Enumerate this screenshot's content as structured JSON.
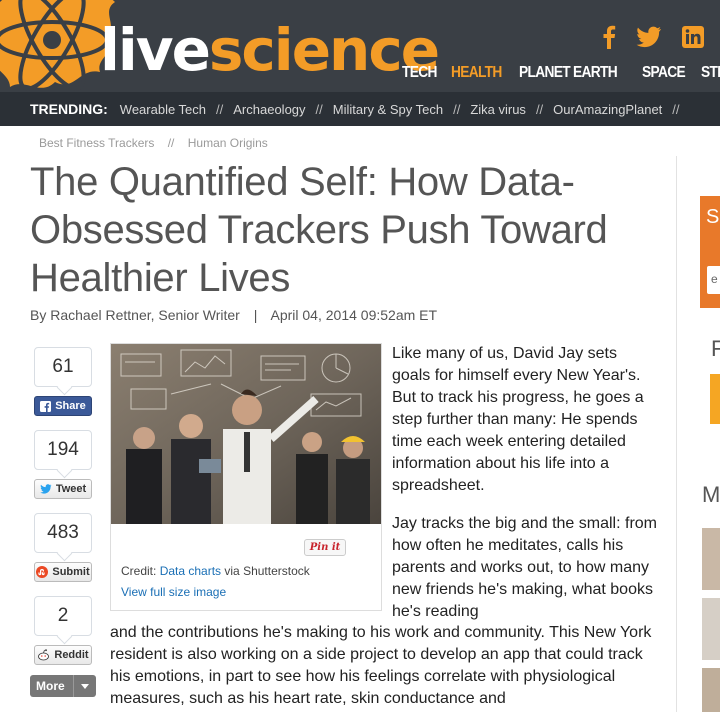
{
  "header": {
    "logo_live": "live",
    "logo_science": "science",
    "brand_colors": {
      "dark": "#3a3f45",
      "orange": "#f39c27"
    },
    "social_icons": [
      "facebook-icon",
      "twitter-icon",
      "linkedin-icon"
    ],
    "nav": [
      {
        "label": "TECH",
        "active": false
      },
      {
        "label": "HEALTH",
        "active": true
      },
      {
        "label": "PLANET EARTH",
        "active": false
      },
      {
        "label": "SPACE",
        "active": false
      },
      {
        "label": "STRANGE NEW",
        "active": false
      }
    ]
  },
  "trending": {
    "label": "TRENDING:",
    "links": [
      "Wearable Tech",
      "Archaeology",
      "Military & Spy Tech",
      "Zika virus",
      "OurAmazingPlanet"
    ],
    "separator": "//"
  },
  "breadcrumb": {
    "items": [
      "Best Fitness Trackers",
      "Human Origins"
    ],
    "separator": "//"
  },
  "article": {
    "title": "The Quantified Self: How Data-Obsessed Trackers Push Toward Healthier Lives",
    "author": "By Rachael Rettner, Senior Writer",
    "date": "April 04, 2014 09:52am ET",
    "byline_separator": "|",
    "p1": "Like many of us, David Jay sets goals for himself every New Year's. But to track his progress, he goes a step further than many: He spends time each week entering detailed information about his life into a spreadsheet.",
    "p2_part1": "Jay tracks the big and the small: from how often he meditates, calls his parents and works out, to how many new friends he's making, what books he's reading",
    "p2_part2": "and the contributions he's making to his work and community. This New York resident is also working on a side project to develop an app that could track his emotions, in part to see how his feelings correlate with physiological measures, such as his heart rate, skin conductance and"
  },
  "figure": {
    "pin_label": "Pin it",
    "credit_prefix": "Credit:",
    "credit_link": "Data charts",
    "credit_suffix": "via Shutterstock",
    "fullsize_link": "View full size image"
  },
  "share": {
    "facebook": {
      "count": "61",
      "label": "Share"
    },
    "twitter": {
      "count": "194",
      "label": "Tweet"
    },
    "stumbleupon": {
      "count": "483",
      "label": "Submit"
    },
    "reddit": {
      "count": "2",
      "label": "Reddit"
    },
    "more_label": "More"
  },
  "rail": {
    "letter_s": "S",
    "input_text": "e",
    "letter_f": "F",
    "letter_m": "M"
  }
}
